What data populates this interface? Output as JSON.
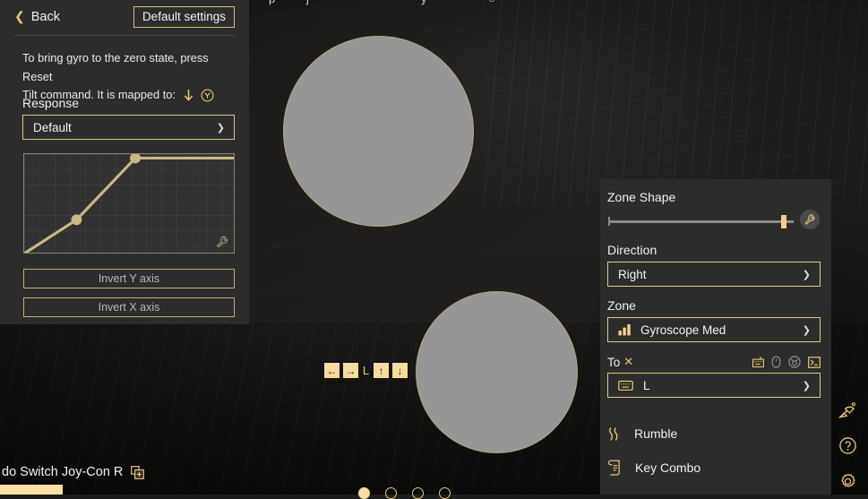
{
  "left_panel": {
    "back_label": "Back",
    "back_icon": "chevron-left-icon",
    "default_settings_label": "Default settings",
    "hint_line1": "To bring gyro to the zero state, press Reset",
    "hint_line2": "Tilt command. It is mapped to:",
    "hint_icons": [
      "arrow-down-icon",
      "y-button-icon"
    ],
    "response_label": "Response",
    "response_value": "Default",
    "response_caret": "chevron-down-icon",
    "curve": {
      "points": [
        [
          0,
          0
        ],
        [
          25,
          34
        ],
        [
          53,
          96
        ],
        [
          100,
          96
        ]
      ],
      "node_points": [
        [
          25,
          34
        ],
        [
          53,
          96
        ]
      ],
      "wrench_icon": "wrench-icon",
      "grid": true,
      "line_color": "#c9b785",
      "node_color": "#cbb887"
    },
    "invert_y_label": "Invert Y axis",
    "invert_x_label": "Invert X axis"
  },
  "center": {
    "circle_top": "deadzone-circle-outer",
    "circle_bottom": "deadzone-circle-inner",
    "arrow_keys": [
      {
        "name": "arrow-left-key",
        "glyph": "←"
      },
      {
        "name": "arrow-right-key",
        "glyph": "→"
      }
    ],
    "stick_label": "L",
    "arrow_keys2": [
      {
        "name": "arrow-up-key",
        "glyph": "↑"
      },
      {
        "name": "arrow-down-key",
        "glyph": "↓"
      }
    ]
  },
  "right_panel": {
    "zone_shape_label": "Zone Shape",
    "zone_shape_value": 96,
    "zone_shape_wrench": "wrench-icon",
    "direction_label": "Direction",
    "direction_value": "Right",
    "zone_label": "Zone",
    "zone_value": "Gyroscope Med",
    "zone_icon": "bar-chart-icon",
    "to_label": "To",
    "to_clear_icon": "close-x-icon",
    "device_icons": [
      {
        "name": "keyboard-icon",
        "active": true
      },
      {
        "name": "mouse-icon",
        "active": false
      },
      {
        "name": "gamepad-circle-icon",
        "active": false
      },
      {
        "name": "console-terminal-icon",
        "active": true
      }
    ],
    "to_value": "L",
    "to_value_icon": "keyboard-icon",
    "rumble_label": "Rumble",
    "rumble_icon": "rumble-wave-icon",
    "key_combo_label": "Key Combo",
    "key_combo_icon": "scroll-list-icon"
  },
  "rail": {
    "items": [
      {
        "name": "satellite-dish-icon",
        "label": "Remote"
      },
      {
        "name": "help-icon",
        "label": "Help"
      },
      {
        "name": "gear-icon",
        "label": "Settings"
      }
    ]
  },
  "bottom": {
    "device_name": "do Switch Joy-Con R",
    "device_add_icon": "add-profile-icon",
    "page_dots": [
      true,
      false,
      false,
      false
    ]
  },
  "colors": {
    "accent": "#e9c877",
    "accent_fill": "#f6dd9e",
    "panel_bg": "#2c2c2c",
    "page_bg": "#222120",
    "circle_fill": "#969696",
    "border_gold": "#e0c685"
  }
}
